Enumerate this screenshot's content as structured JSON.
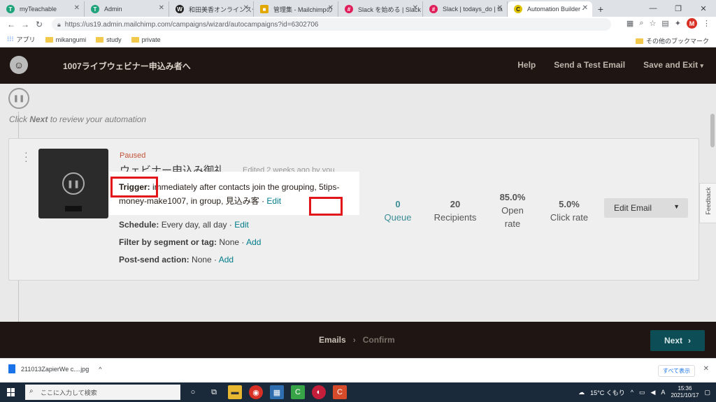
{
  "browser": {
    "tabs": [
      {
        "label": "myTeachable",
        "color": "#1fa37a",
        "glyph": "T"
      },
      {
        "label": "Admin",
        "color": "#1fa37a",
        "glyph": "T"
      },
      {
        "label": "和田美香オンラインスク",
        "color": "#222222",
        "glyph": "W"
      },
      {
        "label": "管理集 - Mailchimpの",
        "color": "#e0a800",
        "glyph": "■"
      },
      {
        "label": "Slack を始める | Slack",
        "color": "#e01e5a",
        "glyph": "#"
      },
      {
        "label": "Slack | todays_do | ta",
        "color": "#e01e5a",
        "glyph": "#"
      },
      {
        "label": "Automation Builder -",
        "color": "#e0c200",
        "glyph": "C"
      }
    ],
    "new_tab": "+",
    "url": "https://us19.admin.mailchimp.com/campaigns/wizard/autocampaigns?id=6302706",
    "profile_initial": "M",
    "bookmarks": [
      "アプリ",
      "mikangumi",
      "study",
      "private"
    ],
    "other_bookmarks": "その他のブックマーク"
  },
  "appbar": {
    "campaign_title": "1007ライブウェビナー申込み者へ",
    "help": "Help",
    "send_test": "Send a Test Email",
    "save_exit": "Save and Exit"
  },
  "hint": {
    "prefix": "Click ",
    "bold": "Next",
    "suffix": " to review your automation"
  },
  "email": {
    "status": "Paused",
    "name": "ウェビナー申込み御礼",
    "edited": "Edited 2 weeks ago by you",
    "trigger_label": "Trigger:",
    "trigger_text": " immediately after contacts join the grouping, 5tips-money-make1007, in group, 見込み客 · ",
    "trigger_edit": "Edit",
    "schedule_label": "Schedule:",
    "schedule_text": " Every day, all day · ",
    "schedule_edit": "Edit",
    "filter_label": "Filter by segment or tag:",
    "filter_text": " None · ",
    "filter_add": "Add",
    "postsend_label": "Post-send action:",
    "postsend_text": " None · ",
    "postsend_add": "Add"
  },
  "stats": {
    "queue_value": "0",
    "queue_label": "Queue",
    "recipients_value": "20",
    "recipients_label": "Recipients",
    "open_value": "85.0%",
    "open_label_1": "Open",
    "open_label_2": "rate",
    "click_value": "5.0%",
    "click_label": "Click rate"
  },
  "edit_email_button": "Edit Email",
  "feedback": "Feedback",
  "footer": {
    "step1": "Emails",
    "step2": "Confirm",
    "next": "Next"
  },
  "download": {
    "file": "211013ZapierWe c....jpg",
    "show_all": "すべて表示"
  },
  "taskbar": {
    "search_placeholder": "ここに入力して検索",
    "weather": "15°C くもり",
    "time": "15:36",
    "date": "2021/10/17"
  }
}
